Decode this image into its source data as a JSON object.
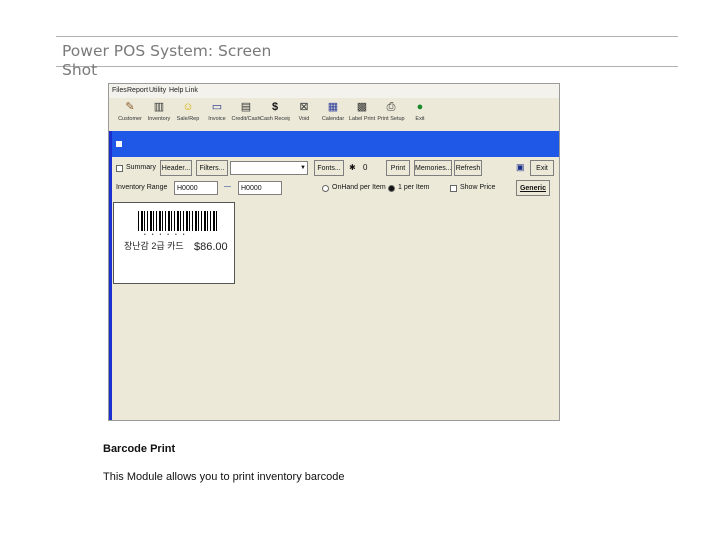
{
  "slide": {
    "title": "Power POS System: Screen Shot",
    "caption_title": "Barcode Print",
    "caption_desc": "This Module allows you to print inventory barcode"
  },
  "menu": [
    "Files",
    "Report",
    "Utility",
    "Help",
    "Link"
  ],
  "toolbar": [
    {
      "label": "Customer",
      "icon": "person-icon"
    },
    {
      "label": "Inventory",
      "icon": "box-icon"
    },
    {
      "label": "Sale/Rep",
      "icon": "smiley-icon"
    },
    {
      "label": "Invoice",
      "icon": "document-icon"
    },
    {
      "label": "Credit/Cash",
      "icon": "register-icon"
    },
    {
      "label": "Cash Receipt",
      "icon": "dollar-icon"
    },
    {
      "label": "Void",
      "icon": "void-icon"
    },
    {
      "label": "Calendar",
      "icon": "calendar-icon"
    },
    {
      "label": "Label Print",
      "icon": "grid-icon"
    },
    {
      "label": "Print Setup",
      "icon": "printer-icon"
    },
    {
      "label": "Exit",
      "icon": "exit-icon"
    }
  ],
  "controls": {
    "summary_label": "Summary",
    "header_btn": "Header...",
    "filters_btn": "Filters...",
    "fonts_btn": "Fonts...",
    "print_btn": "Print",
    "memories_btn": "Memories...",
    "refresh_btn": "Refresh",
    "exit_btn": "Exit",
    "range_label": "Inventory Range",
    "range_from": "H0000",
    "range_to": "H0000",
    "onhand_label": "OnHand per Item",
    "one_per_item_label": "1 per Item",
    "show_price_label": "Show Price",
    "generic_btn": "Generic"
  },
  "label": {
    "item_name": "장난감 2급 카드",
    "price": "$86.00"
  }
}
